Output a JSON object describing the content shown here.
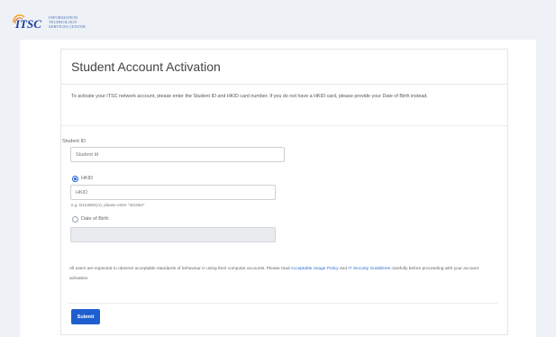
{
  "header": {
    "logo_mark": "ITSC",
    "logo_lines": [
      "INFORMATION",
      "TECHNOLOGY",
      "SERVICES CENTER"
    ],
    "brand_color": "#1a3fa0",
    "accent_color": "#f5a623"
  },
  "form": {
    "title": "Student Account Activation",
    "intro": "To activate your ITSC network account, please enter the Student ID and HKID card number. If you do not have a HKID card, please provide your Date of Birth instead.",
    "student_id_label": "Student ID",
    "student_id_placeholder": "Student Id",
    "hkid_option_label": "HKID",
    "hkid_selected": true,
    "hkid_placeholder": "HKID",
    "hkid_hint": "e.g. D123654(A), please enter \"321654\"",
    "dob_option_label": "Date of Birth",
    "dob_selected": false,
    "dob_value": "",
    "notice_prefix": "All users are expected to observe acceptable standards of behaviour in using their computer accounts. Please read ",
    "aup_link": "Acceptable Usage Policy",
    "notice_middle": " and ",
    "security_link": "IT Security Guidelines",
    "notice_suffix": " carefully before proceeding with your account activation.",
    "submit_label": "Submit",
    "submit_color": "#1e5fd0"
  }
}
